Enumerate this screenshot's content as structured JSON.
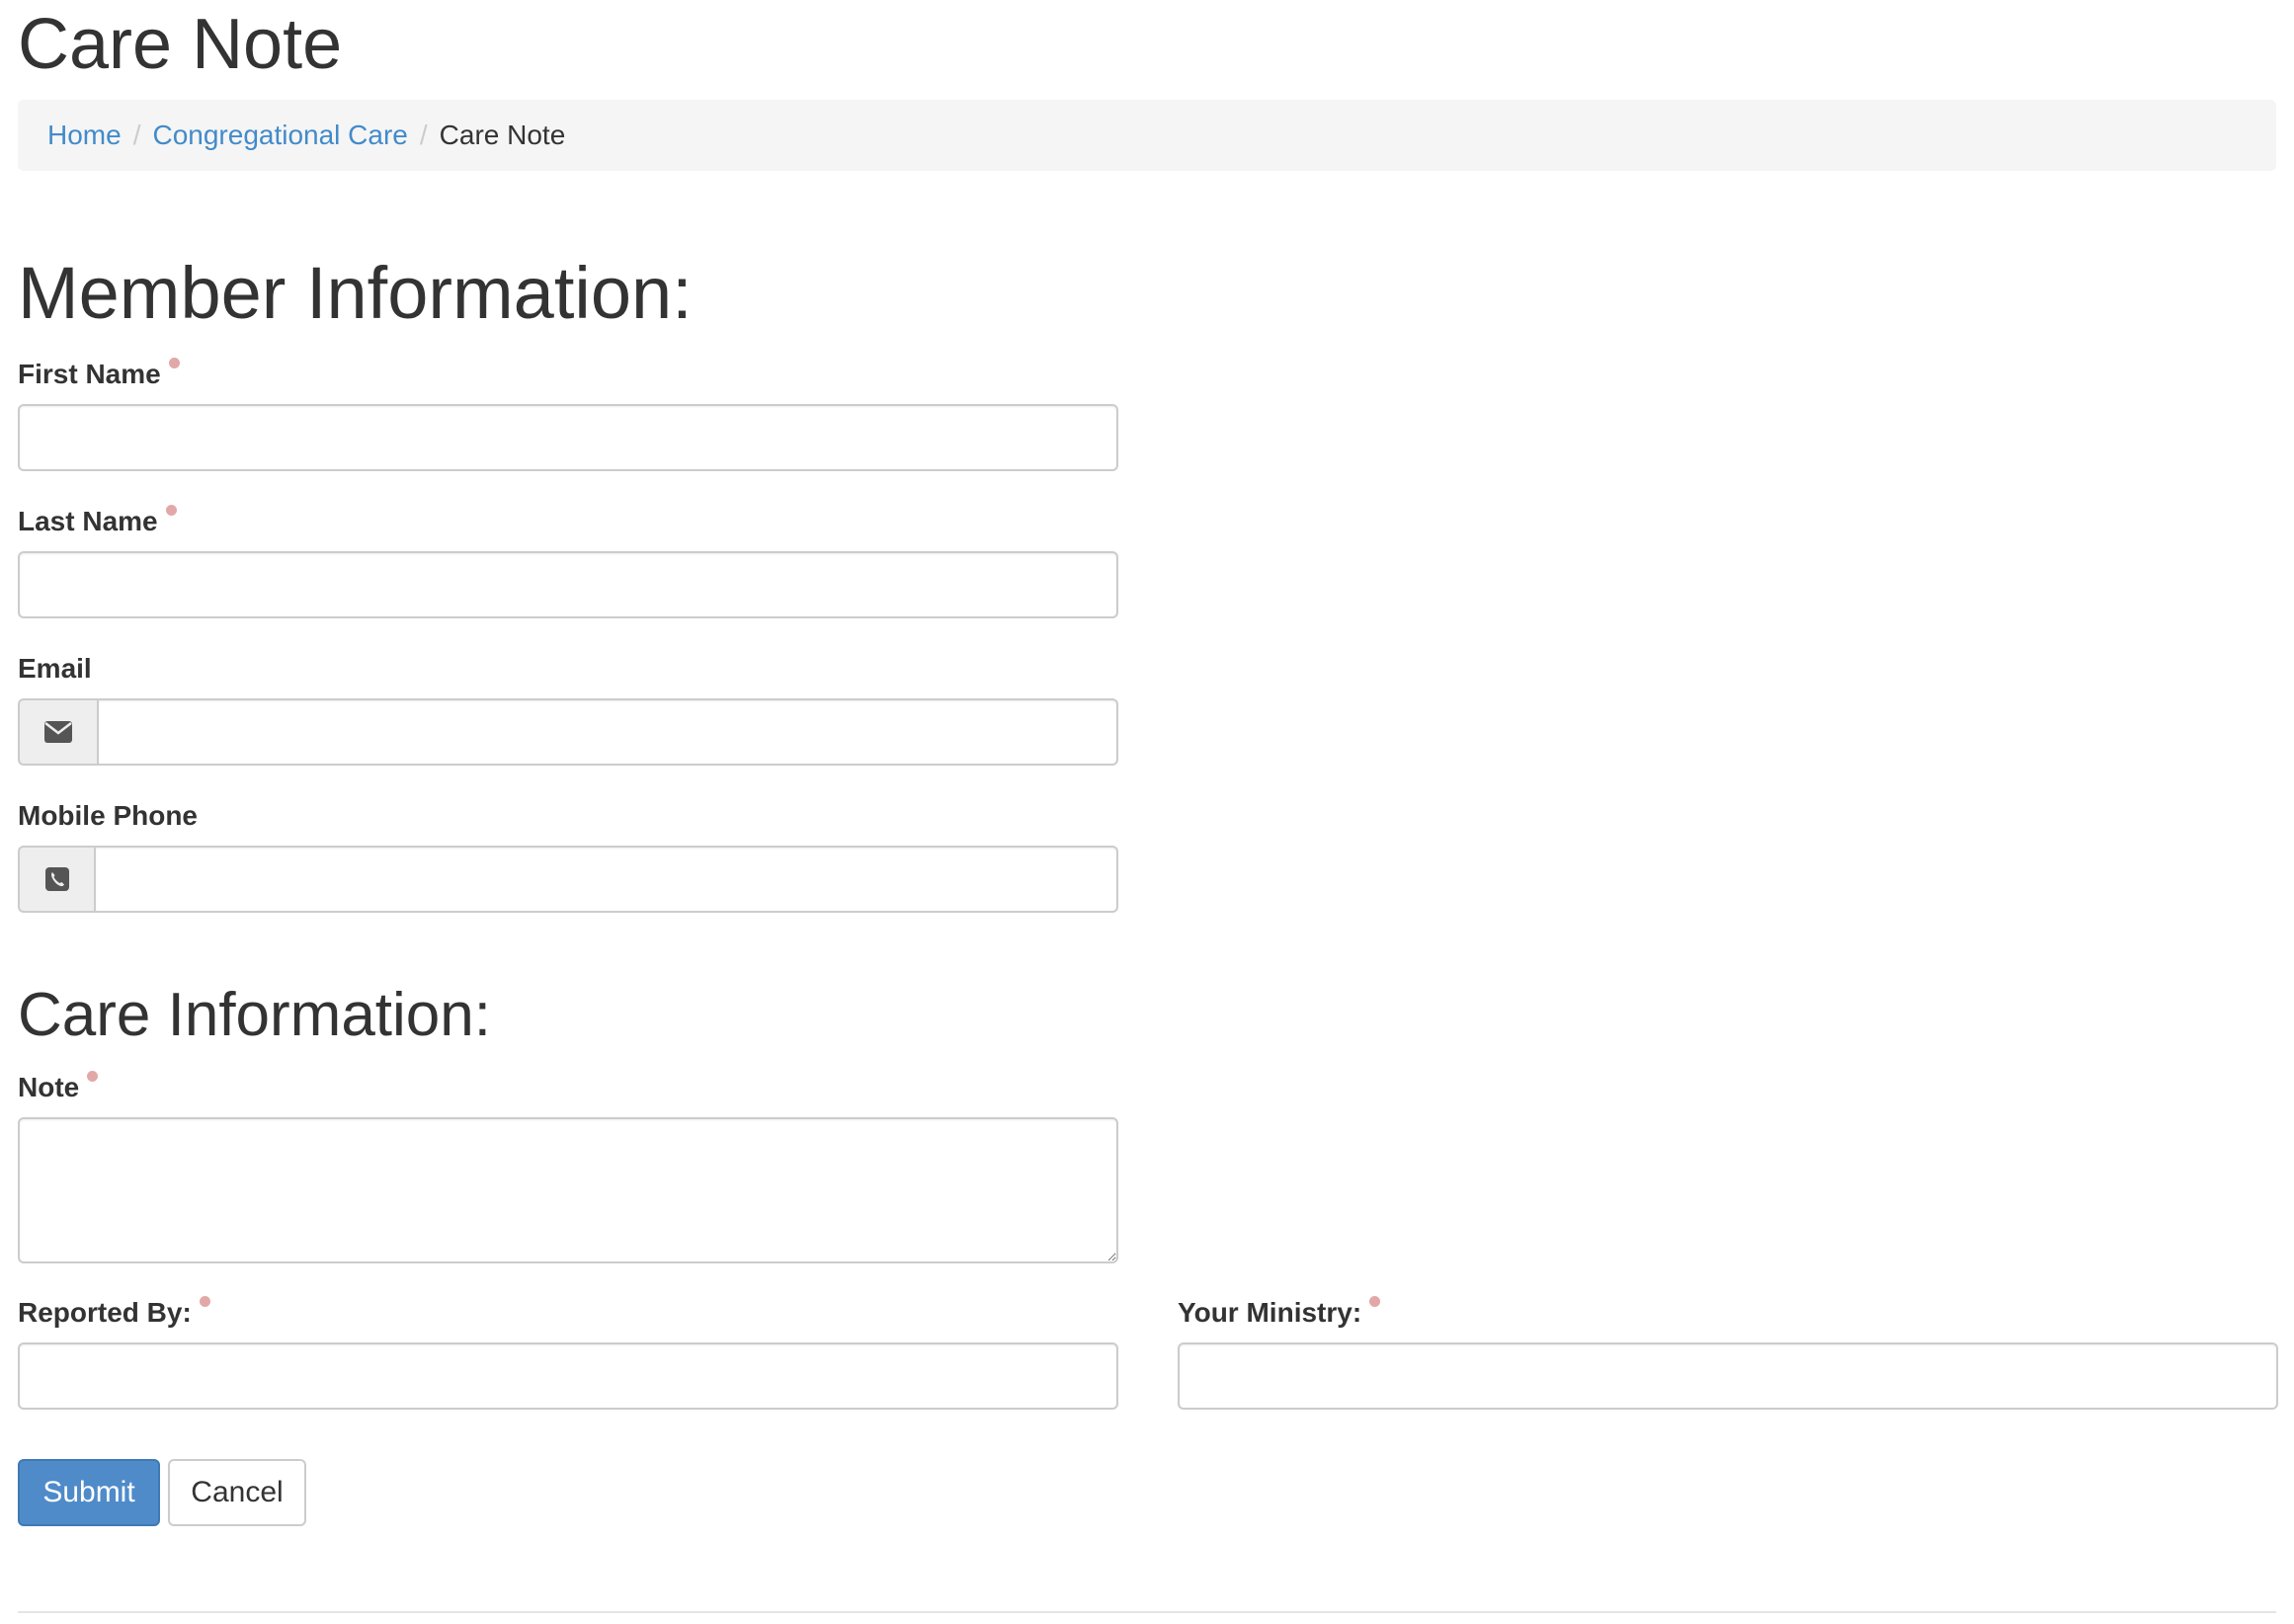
{
  "page": {
    "title": "Care Note"
  },
  "breadcrumb": {
    "items": [
      {
        "label": "Home"
      },
      {
        "label": "Congregational Care"
      },
      {
        "label": "Care Note"
      }
    ],
    "separator": "/"
  },
  "member_section": {
    "heading": "Member Information:",
    "first_name": {
      "label": "First Name",
      "required": true,
      "value": ""
    },
    "last_name": {
      "label": "Last Name",
      "required": true,
      "value": ""
    },
    "email": {
      "label": "Email",
      "icon": "envelope-icon",
      "value": ""
    },
    "mobile_phone": {
      "label": "Mobile Phone",
      "icon": "phone-square-icon",
      "value": ""
    }
  },
  "care_section": {
    "heading": "Care Information:",
    "note": {
      "label": "Note",
      "required": true,
      "value": ""
    },
    "reported_by": {
      "label": "Reported By:",
      "required": true,
      "value": ""
    },
    "your_ministry": {
      "label": "Your Ministry:",
      "required": true,
      "value": ""
    }
  },
  "actions": {
    "submit_label": "Submit",
    "cancel_label": "Cancel"
  },
  "colors": {
    "link": "#428bca",
    "primary_button": "#4f8bc9",
    "required_indicator": "#e2a8a8",
    "breadcrumb_bg": "#f5f5f5",
    "addon_bg": "#eeeeee"
  }
}
